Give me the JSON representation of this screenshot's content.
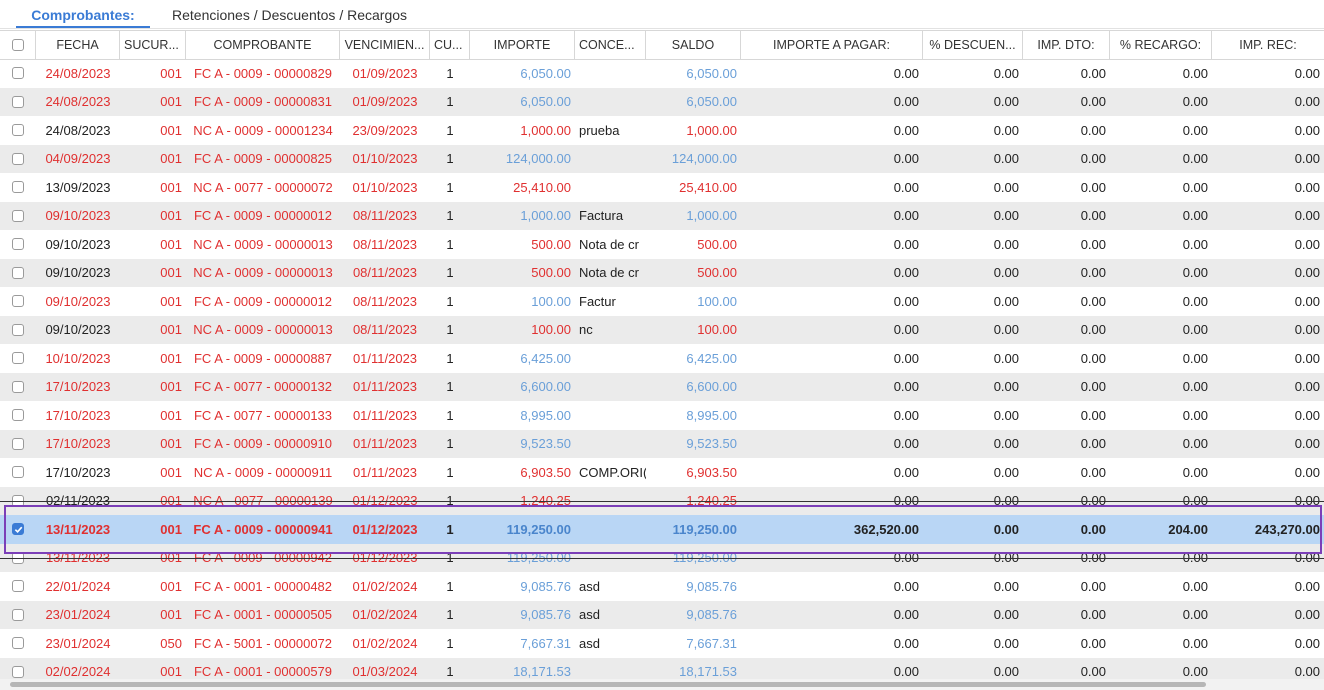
{
  "tabs": [
    "Comprobantes:",
    "Retenciones / Descuentos / Recargos"
  ],
  "columns": [
    "FECHA",
    "SUCUR...",
    "COMPROBANTE",
    "VENCIMIEN...",
    "CU...",
    "IMPORTE",
    "CONCE...",
    "SALDO",
    "IMPORTE A PAGAR:",
    "% DESCUEN...",
    "IMP. DTO:",
    "% RECARGO:",
    "IMP. REC:"
  ],
  "rows": [
    {
      "fecha": "24/08/2023",
      "suc": "001",
      "comp": "FC A - 0009 - 00000829",
      "venc": "01/09/2023",
      "cu": "1",
      "importe": "6,050.00",
      "conc": "",
      "saldo": "6,050.00",
      "pagar": "0.00",
      "pdesc": "0.00",
      "impdto": "0.00",
      "prec": "0.00",
      "imprec": "0.00",
      "fechaColor": "red",
      "impColor": "blue",
      "checked": false
    },
    {
      "fecha": "24/08/2023",
      "suc": "001",
      "comp": "FC A - 0009 - 00000831",
      "venc": "01/09/2023",
      "cu": "1",
      "importe": "6,050.00",
      "conc": "",
      "saldo": "6,050.00",
      "pagar": "0.00",
      "pdesc": "0.00",
      "impdto": "0.00",
      "prec": "0.00",
      "imprec": "0.00",
      "fechaColor": "red",
      "impColor": "blue",
      "checked": false
    },
    {
      "fecha": "24/08/2023",
      "suc": "001",
      "comp": "NC A - 0009 - 00001234",
      "venc": "23/09/2023",
      "cu": "1",
      "importe": "1,000.00",
      "conc": "prueba",
      "saldo": "1,000.00",
      "pagar": "0.00",
      "pdesc": "0.00",
      "impdto": "0.00",
      "prec": "0.00",
      "imprec": "0.00",
      "fechaColor": "dark",
      "impColor": "red",
      "checked": false
    },
    {
      "fecha": "04/09/2023",
      "suc": "001",
      "comp": "FC A - 0009 - 00000825",
      "venc": "01/10/2023",
      "cu": "1",
      "importe": "124,000.00",
      "conc": "",
      "saldo": "124,000.00",
      "pagar": "0.00",
      "pdesc": "0.00",
      "impdto": "0.00",
      "prec": "0.00",
      "imprec": "0.00",
      "fechaColor": "red",
      "impColor": "blue",
      "checked": false
    },
    {
      "fecha": "13/09/2023",
      "suc": "001",
      "comp": "NC A - 0077 - 00000072",
      "venc": "01/10/2023",
      "cu": "1",
      "importe": "25,410.00",
      "conc": "",
      "saldo": "25,410.00",
      "pagar": "0.00",
      "pdesc": "0.00",
      "impdto": "0.00",
      "prec": "0.00",
      "imprec": "0.00",
      "fechaColor": "dark",
      "impColor": "red",
      "checked": false
    },
    {
      "fecha": "09/10/2023",
      "suc": "001",
      "comp": "FC A - 0009 - 00000012",
      "venc": "08/11/2023",
      "cu": "1",
      "importe": "1,000.00",
      "conc": "Factura",
      "saldo": "1,000.00",
      "pagar": "0.00",
      "pdesc": "0.00",
      "impdto": "0.00",
      "prec": "0.00",
      "imprec": "0.00",
      "fechaColor": "red",
      "impColor": "blue",
      "checked": false
    },
    {
      "fecha": "09/10/2023",
      "suc": "001",
      "comp": "NC A - 0009 - 00000013",
      "venc": "08/11/2023",
      "cu": "1",
      "importe": "500.00",
      "conc": "Nota de cr",
      "saldo": "500.00",
      "pagar": "0.00",
      "pdesc": "0.00",
      "impdto": "0.00",
      "prec": "0.00",
      "imprec": "0.00",
      "fechaColor": "dark",
      "impColor": "red",
      "checked": false
    },
    {
      "fecha": "09/10/2023",
      "suc": "001",
      "comp": "NC A - 0009 - 00000013",
      "venc": "08/11/2023",
      "cu": "1",
      "importe": "500.00",
      "conc": "Nota de cr",
      "saldo": "500.00",
      "pagar": "0.00",
      "pdesc": "0.00",
      "impdto": "0.00",
      "prec": "0.00",
      "imprec": "0.00",
      "fechaColor": "dark",
      "impColor": "red",
      "checked": false
    },
    {
      "fecha": "09/10/2023",
      "suc": "001",
      "comp": "FC A - 0009 - 00000012",
      "venc": "08/11/2023",
      "cu": "1",
      "importe": "100.00",
      "conc": "Factur",
      "saldo": "100.00",
      "pagar": "0.00",
      "pdesc": "0.00",
      "impdto": "0.00",
      "prec": "0.00",
      "imprec": "0.00",
      "fechaColor": "red",
      "impColor": "blue",
      "checked": false
    },
    {
      "fecha": "09/10/2023",
      "suc": "001",
      "comp": "NC A - 0009 - 00000013",
      "venc": "08/11/2023",
      "cu": "1",
      "importe": "100.00",
      "conc": "nc",
      "saldo": "100.00",
      "pagar": "0.00",
      "pdesc": "0.00",
      "impdto": "0.00",
      "prec": "0.00",
      "imprec": "0.00",
      "fechaColor": "dark",
      "impColor": "red",
      "checked": false
    },
    {
      "fecha": "10/10/2023",
      "suc": "001",
      "comp": "FC A - 0009 - 00000887",
      "venc": "01/11/2023",
      "cu": "1",
      "importe": "6,425.00",
      "conc": "",
      "saldo": "6,425.00",
      "pagar": "0.00",
      "pdesc": "0.00",
      "impdto": "0.00",
      "prec": "0.00",
      "imprec": "0.00",
      "fechaColor": "red",
      "impColor": "blue",
      "checked": false
    },
    {
      "fecha": "17/10/2023",
      "suc": "001",
      "comp": "FC A - 0077 - 00000132",
      "venc": "01/11/2023",
      "cu": "1",
      "importe": "6,600.00",
      "conc": "",
      "saldo": "6,600.00",
      "pagar": "0.00",
      "pdesc": "0.00",
      "impdto": "0.00",
      "prec": "0.00",
      "imprec": "0.00",
      "fechaColor": "red",
      "impColor": "blue",
      "checked": false
    },
    {
      "fecha": "17/10/2023",
      "suc": "001",
      "comp": "FC A - 0077 - 00000133",
      "venc": "01/11/2023",
      "cu": "1",
      "importe": "8,995.00",
      "conc": "",
      "saldo": "8,995.00",
      "pagar": "0.00",
      "pdesc": "0.00",
      "impdto": "0.00",
      "prec": "0.00",
      "imprec": "0.00",
      "fechaColor": "red",
      "impColor": "blue",
      "checked": false
    },
    {
      "fecha": "17/10/2023",
      "suc": "001",
      "comp": "FC A - 0009 - 00000910",
      "venc": "01/11/2023",
      "cu": "1",
      "importe": "9,523.50",
      "conc": "",
      "saldo": "9,523.50",
      "pagar": "0.00",
      "pdesc": "0.00",
      "impdto": "0.00",
      "prec": "0.00",
      "imprec": "0.00",
      "fechaColor": "red",
      "impColor": "blue",
      "checked": false
    },
    {
      "fecha": "17/10/2023",
      "suc": "001",
      "comp": "NC A - 0009 - 00000911",
      "venc": "01/11/2023",
      "cu": "1",
      "importe": "6,903.50",
      "conc": "COMP.ORI(",
      "saldo": "6,903.50",
      "pagar": "0.00",
      "pdesc": "0.00",
      "impdto": "0.00",
      "prec": "0.00",
      "imprec": "0.00",
      "fechaColor": "dark",
      "impColor": "red",
      "checked": false
    },
    {
      "fecha": "02/11/2023",
      "suc": "001",
      "comp": "NC A - 0077 - 00000139",
      "venc": "01/12/2023",
      "cu": "1",
      "importe": "1,240.25",
      "conc": "",
      "saldo": "1,240.25",
      "pagar": "0.00",
      "pdesc": "0.00",
      "impdto": "0.00",
      "prec": "0.00",
      "imprec": "0.00",
      "fechaColor": "dark",
      "impColor": "red",
      "checked": false,
      "struck": true
    },
    {
      "fecha": "13/11/2023",
      "suc": "001",
      "comp": "FC A - 0009 - 00000941",
      "venc": "01/12/2023",
      "cu": "1",
      "importe": "119,250.00",
      "conc": "",
      "saldo": "119,250.00",
      "pagar": "362,520.00",
      "pdesc": "0.00",
      "impdto": "0.00",
      "prec": "204.00",
      "imprec": "243,270.00",
      "fechaColor": "red",
      "impColor": "blue",
      "checked": true,
      "selected": true
    },
    {
      "fecha": "13/11/2023",
      "suc": "001",
      "comp": "FC A - 0009 - 00000942",
      "venc": "01/12/2023",
      "cu": "1",
      "importe": "119,250.00",
      "conc": "",
      "saldo": "119,250.00",
      "pagar": "0.00",
      "pdesc": "0.00",
      "impdto": "0.00",
      "prec": "0.00",
      "imprec": "0.00",
      "fechaColor": "red",
      "impColor": "blue",
      "checked": false,
      "struck": true
    },
    {
      "fecha": "22/01/2024",
      "suc": "001",
      "comp": "FC A - 0001 - 00000482",
      "venc": "01/02/2024",
      "cu": "1",
      "importe": "9,085.76",
      "conc": "asd",
      "saldo": "9,085.76",
      "pagar": "0.00",
      "pdesc": "0.00",
      "impdto": "0.00",
      "prec": "0.00",
      "imprec": "0.00",
      "fechaColor": "red",
      "impColor": "blue",
      "checked": false
    },
    {
      "fecha": "23/01/2024",
      "suc": "001",
      "comp": "FC A - 0001 - 00000505",
      "venc": "01/02/2024",
      "cu": "1",
      "importe": "9,085.76",
      "conc": "asd",
      "saldo": "9,085.76",
      "pagar": "0.00",
      "pdesc": "0.00",
      "impdto": "0.00",
      "prec": "0.00",
      "imprec": "0.00",
      "fechaColor": "red",
      "impColor": "blue",
      "checked": false
    },
    {
      "fecha": "23/01/2024",
      "suc": "050",
      "comp": "FC A - 5001 - 00000072",
      "venc": "01/02/2024",
      "cu": "1",
      "importe": "7,667.31",
      "conc": "asd",
      "saldo": "7,667.31",
      "pagar": "0.00",
      "pdesc": "0.00",
      "impdto": "0.00",
      "prec": "0.00",
      "imprec": "0.00",
      "fechaColor": "red",
      "impColor": "blue",
      "checked": false
    },
    {
      "fecha": "02/02/2024",
      "suc": "001",
      "comp": "FC A - 0001 - 00000579",
      "venc": "01/03/2024",
      "cu": "1",
      "importe": "18,171.53",
      "conc": "",
      "saldo": "18,171.53",
      "pagar": "0.00",
      "pdesc": "0.00",
      "impdto": "0.00",
      "prec": "0.00",
      "imprec": "0.00",
      "fechaColor": "red",
      "impColor": "blue",
      "checked": false
    }
  ]
}
